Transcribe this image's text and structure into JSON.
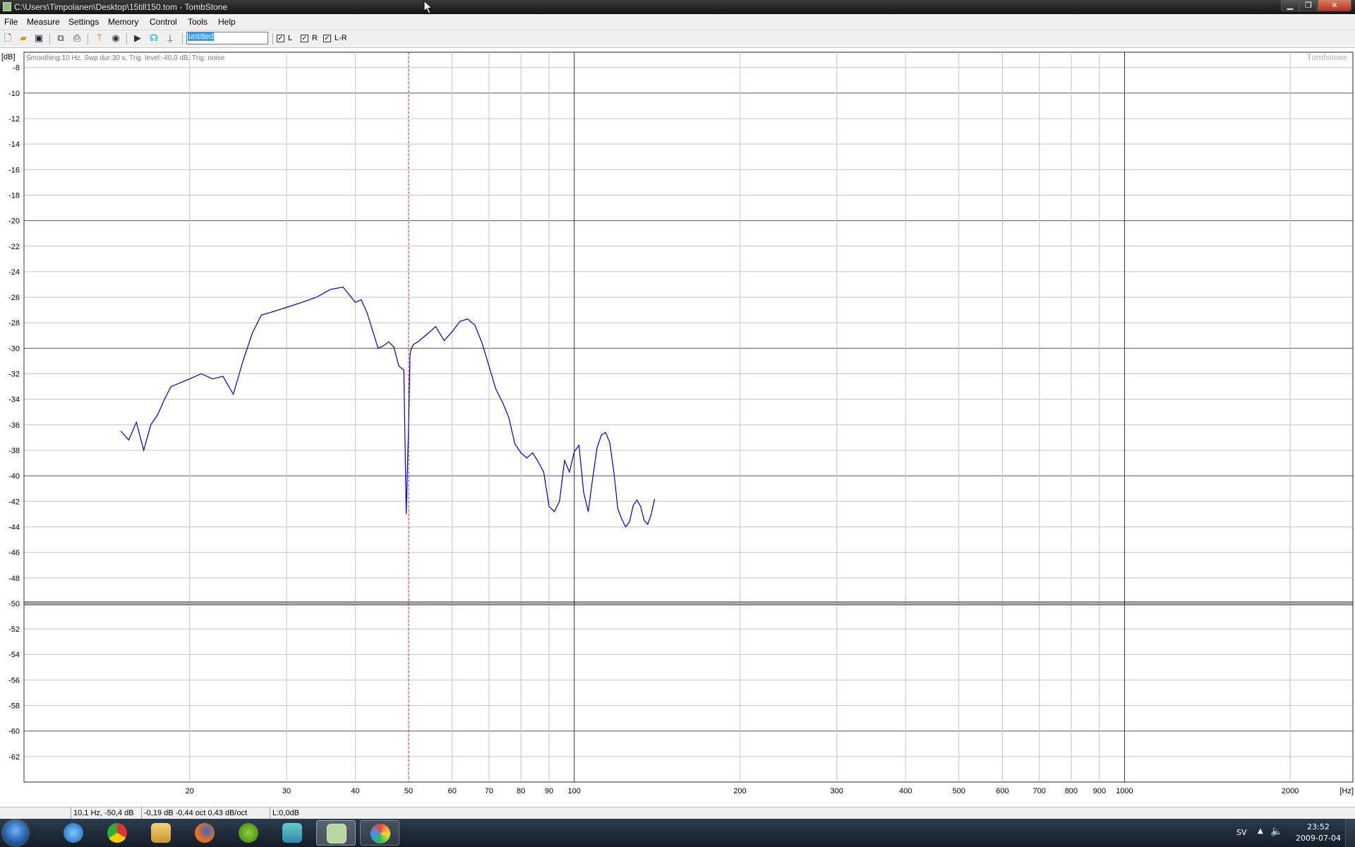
{
  "window": {
    "title": "C:\\Users\\Timpolanen\\Desktop\\15till150.tom - TombStone",
    "min_glyph": "▁",
    "max_glyph": "❐",
    "close_glyph": "✕"
  },
  "menu": [
    "File",
    "Measure",
    "Settings",
    "Memory",
    "Control",
    "Tools",
    "Help"
  ],
  "toolbar": {
    "icons": [
      "new-file-icon",
      "open-folder-icon",
      "save-icon",
      "copy-icon",
      "print-icon",
      "microphone-icon",
      "target-icon",
      "play-icon",
      "headphones-icon",
      "antenna-icon"
    ],
    "name_value": "untitled",
    "channels": [
      {
        "label": "L",
        "checked": true
      },
      {
        "label": "R",
        "checked": true
      },
      {
        "label": "L-R",
        "checked": true
      }
    ]
  },
  "chart_data": {
    "type": "line",
    "ylabel": "[dB]",
    "xlabel": "[Hz]",
    "x_scale": "log",
    "xlim": [
      10,
      2600
    ],
    "ylim": [
      -64,
      -6.8
    ],
    "grid": true,
    "info": "Smoothing:10 Hz, Swp dur:30 s, Trig. level:-40,0 dB, Trig: noise",
    "watermark": "Tombstone",
    "y_ticks": [
      -8,
      -10,
      -12,
      -14,
      -16,
      -18,
      -20,
      -22,
      -24,
      -26,
      -28,
      -30,
      -32,
      -34,
      -36,
      -38,
      -40,
      -42,
      -44,
      -46,
      -48,
      -50,
      -52,
      -54,
      -56,
      -58,
      -60,
      -62
    ],
    "x_ticks": [
      20,
      30,
      40,
      50,
      60,
      70,
      80,
      90,
      100,
      200,
      300,
      400,
      500,
      600,
      700,
      800,
      900,
      1000,
      2000
    ],
    "marker_hz": 50,
    "reference_db": -50,
    "series": [
      {
        "color": "#0000aa",
        "x": [
          15.0,
          15.5,
          16.0,
          16.5,
          17.0,
          17.5,
          18.0,
          18.5,
          19.0,
          20.0,
          21.0,
          22.0,
          23.0,
          24.0,
          25.0,
          26.0,
          27.0,
          28.0,
          30.0,
          32.0,
          34.0,
          36.0,
          38.0,
          40.0,
          41.0,
          42.0,
          43.0,
          44.0,
          45.0,
          46.0,
          47.0,
          48.0,
          49.0,
          49.5,
          50.0,
          50.3,
          50.5,
          51.0,
          52.0,
          54.0,
          56.0,
          58.0,
          60.0,
          62.0,
          64.0,
          66.0,
          68.0,
          70.0,
          72.0,
          74.0,
          76.0,
          78.0,
          80.0,
          82.0,
          84.0,
          86.0,
          88.0,
          90.0,
          92.0,
          94.0,
          96.0,
          98.0,
          100.0,
          102.0,
          104.0,
          106.0,
          108.0,
          110.0,
          112.0,
          114.0,
          116.0,
          118.0,
          120.0,
          122.0,
          124.0,
          126.0,
          128.0,
          130.0,
          132.0,
          134.0,
          136.0,
          138.0,
          140.0
        ],
        "y": [
          -36.5,
          -37.2,
          -35.8,
          -38.0,
          -36.0,
          -35.2,
          -34.0,
          -33.0,
          -32.8,
          -32.4,
          -32.0,
          -32.4,
          -32.2,
          -33.6,
          -31.0,
          -28.8,
          -27.4,
          -27.2,
          -26.8,
          -26.4,
          -26.0,
          -25.4,
          -25.2,
          -26.4,
          -26.2,
          -27.2,
          -28.6,
          -30.0,
          -29.8,
          -29.5,
          -29.9,
          -31.4,
          -31.7,
          -43.0,
          -36.0,
          -30.5,
          -30.1,
          -29.7,
          -29.5,
          -28.9,
          -28.3,
          -29.4,
          -28.7,
          -27.9,
          -27.7,
          -28.2,
          -29.6,
          -31.4,
          -33.2,
          -34.2,
          -35.4,
          -37.5,
          -38.2,
          -38.6,
          -38.2,
          -38.9,
          -39.7,
          -42.4,
          -42.8,
          -42.0,
          -38.8,
          -39.7,
          -38.1,
          -37.6,
          -41.3,
          -42.8,
          -40.2,
          -37.8,
          -36.8,
          -36.6,
          -37.4,
          -39.7,
          -42.6,
          -43.4,
          -44.0,
          -43.6,
          -42.3,
          -41.9,
          -42.4,
          -43.5,
          -43.8,
          -43.0,
          -41.8
        ]
      }
    ]
  },
  "status": {
    "cursor": "10,1 Hz, -50,4 dB",
    "slope": "-0,19 dB -0,44 oct 0,43 dB/oct",
    "level": "L:0,0dB"
  },
  "taskbar": {
    "apps": [
      "internet-explorer-icon",
      "chrome-icon",
      "folder-icon",
      "firefox-icon",
      "spotify-icon",
      "messenger-icon",
      "tombstone-icon",
      "paint-icon"
    ],
    "lang": "SV",
    "time": "23:52",
    "date": "2009-07-04"
  }
}
